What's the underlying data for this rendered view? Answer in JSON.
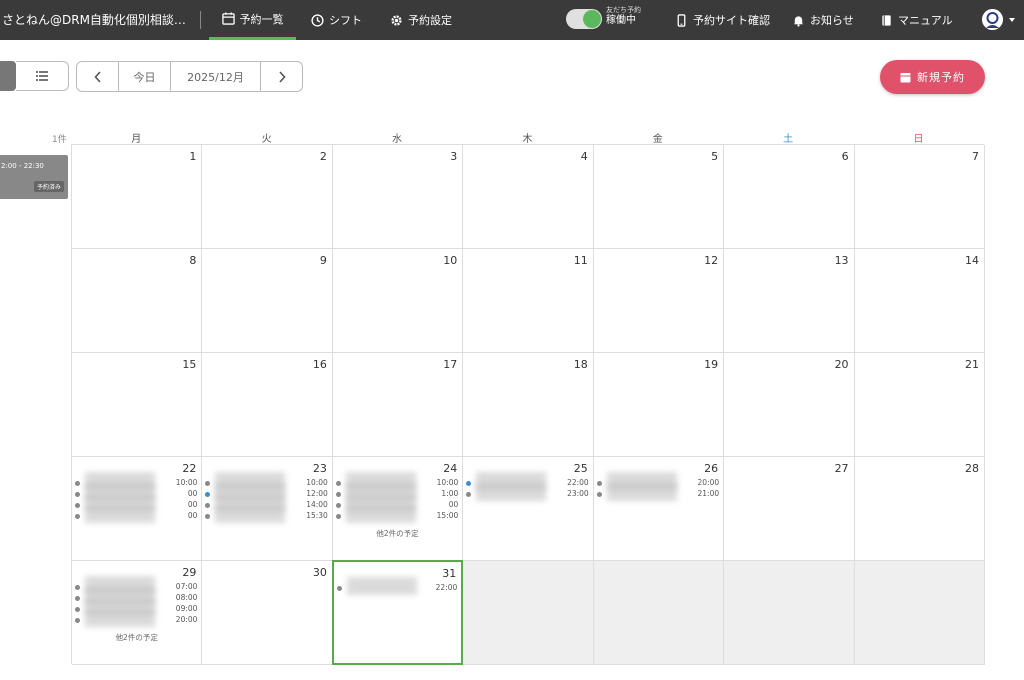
{
  "nav": {
    "app_title": "さとねん@DRM自動化個別相談…",
    "items": [
      {
        "label": "予約一覧",
        "active": true
      },
      {
        "label": "シフト",
        "active": false
      },
      {
        "label": "予約設定",
        "active": false
      }
    ],
    "toggle_caption": "友だち予約",
    "toggle_status": "稼働中",
    "right_items": [
      {
        "label": "予約サイト確認",
        "icon": "phone-icon"
      },
      {
        "label": "お知らせ",
        "icon": "bell-icon"
      },
      {
        "label": "マニュアル",
        "icon": "book-icon"
      }
    ]
  },
  "toolbar": {
    "today_label": "今日",
    "current_month": "2025/12月",
    "new_button_label": "新規予約"
  },
  "calendar": {
    "count_label": "1件",
    "side_card": {
      "time": "2:00 - 22:30",
      "badge": "予約済み"
    },
    "weekdays": [
      "月",
      "火",
      "水",
      "木",
      "金",
      "土",
      "日"
    ],
    "weekday_colors": {
      "sat": "#3b8fd6",
      "sun": "#e0526a"
    },
    "days": [
      {
        "d": "1"
      },
      {
        "d": "2"
      },
      {
        "d": "3"
      },
      {
        "d": "4"
      },
      {
        "d": "5"
      },
      {
        "d": "6"
      },
      {
        "d": "7"
      },
      {
        "d": "8"
      },
      {
        "d": "9"
      },
      {
        "d": "10"
      },
      {
        "d": "11"
      },
      {
        "d": "12"
      },
      {
        "d": "13"
      },
      {
        "d": "14"
      },
      {
        "d": "15"
      },
      {
        "d": "16"
      },
      {
        "d": "17"
      },
      {
        "d": "18"
      },
      {
        "d": "19"
      },
      {
        "d": "20"
      },
      {
        "d": "21"
      },
      {
        "d": "22",
        "events": [
          {
            "time": "10:00"
          },
          {
            "time": "00"
          },
          {
            "time": "00"
          },
          {
            "time": "00"
          }
        ]
      },
      {
        "d": "23",
        "events": [
          {
            "time": "10:00"
          },
          {
            "time": "12:00",
            "blue": true
          },
          {
            "time": "14:00"
          },
          {
            "time": "15:30"
          }
        ]
      },
      {
        "d": "24",
        "events": [
          {
            "time": "10:00"
          },
          {
            "time": "1:00"
          },
          {
            "time": "00"
          },
          {
            "time": "15:00"
          }
        ],
        "more": "他2件の予定"
      },
      {
        "d": "25",
        "events": [
          {
            "time": "22:00",
            "blue": true
          },
          {
            "time": "23:00"
          }
        ]
      },
      {
        "d": "26",
        "events": [
          {
            "time": "20:00"
          },
          {
            "time": "21:00"
          }
        ]
      },
      {
        "d": "27"
      },
      {
        "d": "28"
      },
      {
        "d": "29",
        "events": [
          {
            "time": "07:00"
          },
          {
            "time": "08:00"
          },
          {
            "time": "09:00"
          },
          {
            "time": "20:00"
          }
        ],
        "more": "他2件の予定"
      },
      {
        "d": "30"
      },
      {
        "d": "31",
        "events": [
          {
            "time": "22:00"
          }
        ],
        "today": true
      },
      {
        "empty": true
      },
      {
        "empty": true
      },
      {
        "empty": true
      },
      {
        "empty": true
      }
    ]
  }
}
